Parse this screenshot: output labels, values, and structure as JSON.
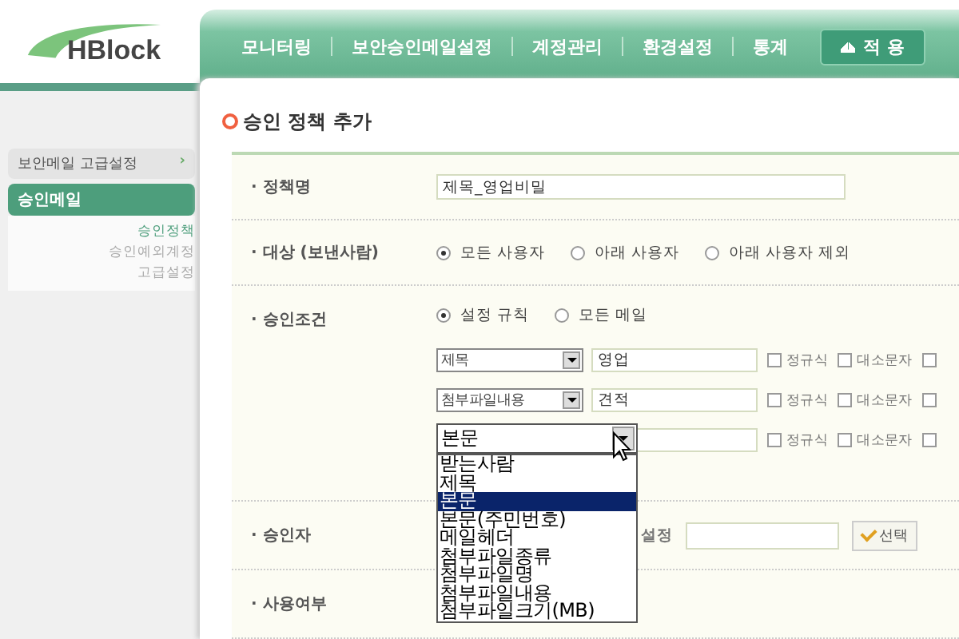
{
  "logo": {
    "text": "HBlock"
  },
  "nav": [
    {
      "label": "모니터링"
    },
    {
      "label": "보안승인메일설정"
    },
    {
      "label": "계정관리"
    },
    {
      "label": "환경설정"
    },
    {
      "label": "통계"
    }
  ],
  "apply_button": {
    "label": "적 용"
  },
  "sidebar": {
    "group": {
      "label": "보안메일 고급설정",
      "arrow": "›"
    },
    "section": {
      "label": "승인메일"
    },
    "items": [
      {
        "label": "승인정책",
        "selected": true
      },
      {
        "label": "승인예외계정",
        "selected": false
      },
      {
        "label": "고급설정",
        "selected": false
      }
    ]
  },
  "title": "승인 정책 추가",
  "policy_name": {
    "label": "· 정책명",
    "value": "제목_영업비밀"
  },
  "target": {
    "label": "· 대상 (보낸사람)",
    "options": [
      {
        "label": "모든 사용자",
        "selected": true
      },
      {
        "label": "아래 사용자",
        "selected": false
      },
      {
        "label": "아래 사용자 제외",
        "selected": false
      }
    ]
  },
  "condition": {
    "label": "· 승인조건",
    "options": [
      {
        "label": "설정 규칙",
        "selected": true
      },
      {
        "label": "모든 메일",
        "selected": false
      }
    ],
    "rules": [
      {
        "field": "제목",
        "keyword": "영업",
        "open": false,
        "checks": [
          {
            "label": "정규식",
            "checked": false
          },
          {
            "label": "대소문자",
            "checked": false
          },
          {
            "checked": false
          }
        ]
      },
      {
        "field": "첨부파일내용",
        "keyword": "견적",
        "open": false,
        "checks": [
          {
            "label": "정규식",
            "checked": false
          },
          {
            "label": "대소문자",
            "checked": false
          },
          {
            "checked": false
          }
        ]
      },
      {
        "field": "본문",
        "open": true,
        "checks": [
          {
            "label": "정규식",
            "checked": false
          },
          {
            "label": "대소문자",
            "checked": false
          },
          {
            "checked": false
          }
        ],
        "list": [
          {
            "label": "받는사람",
            "selected": false
          },
          {
            "label": "제목",
            "selected": false
          },
          {
            "label": "본문",
            "selected": true
          },
          {
            "label": "본문(주민번호)",
            "selected": false
          },
          {
            "label": "메일헤더",
            "selected": false
          },
          {
            "label": "첨부파일종류",
            "selected": false
          },
          {
            "label": "첨부파일명",
            "selected": false
          },
          {
            "label": "첨부파일내용",
            "selected": false
          },
          {
            "label": "첨부파일크기(MB)",
            "selected": false
          }
        ]
      }
    ]
  },
  "approver": {
    "label": "· 승인자",
    "text": "설정",
    "button": "선택"
  },
  "usage": {
    "label": "· 사용여부"
  }
}
